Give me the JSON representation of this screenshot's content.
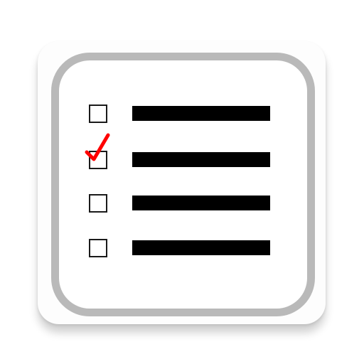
{
  "app_icon": {
    "icon": "checklist-icon",
    "colors": {
      "tile": "#fdfdfd",
      "frame": "#b9b9b9",
      "line": "#000000",
      "check": "#ff0000"
    },
    "items": [
      {
        "checked": false
      },
      {
        "checked": true
      },
      {
        "checked": false
      },
      {
        "checked": false
      }
    ]
  }
}
